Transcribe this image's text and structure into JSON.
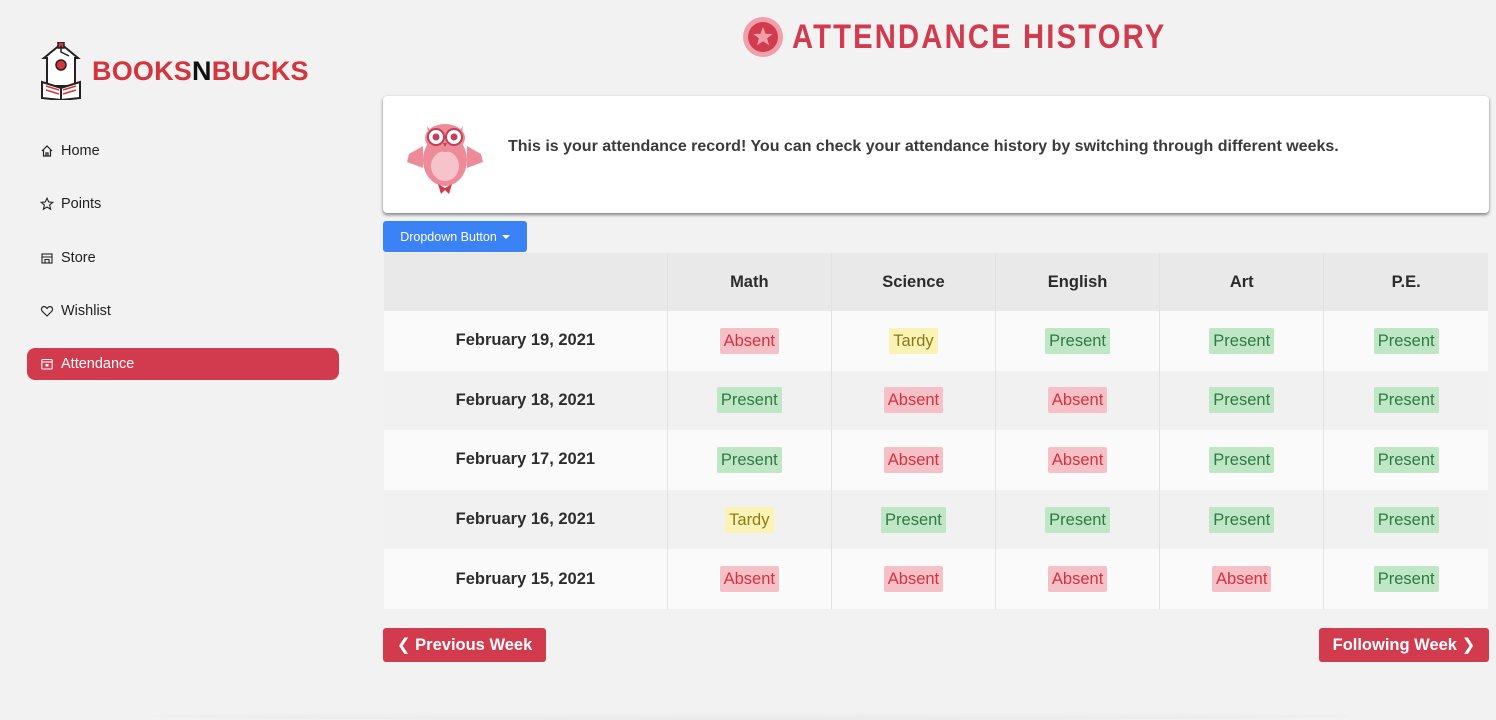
{
  "app": {
    "logo_part1": "BOOKS",
    "logo_part2": "N",
    "logo_part3": "BUCKS"
  },
  "sidebar": {
    "items": [
      {
        "label": "Home",
        "icon": "home-icon",
        "active": false
      },
      {
        "label": "Points",
        "icon": "star-icon",
        "active": false
      },
      {
        "label": "Store",
        "icon": "store-icon",
        "active": false
      },
      {
        "label": "Wishlist",
        "icon": "heart-icon",
        "active": false
      },
      {
        "label": "Attendance",
        "icon": "calendar-icon",
        "active": true
      }
    ]
  },
  "header": {
    "title": "ATTENDANCE HISTORY",
    "icon": "star-badge-icon"
  },
  "info": {
    "message": "This is your attendance record! You can check your attendance history by switching through different weeks.",
    "mascot": "owl-icon"
  },
  "dropdown": {
    "label": "Dropdown Button"
  },
  "table": {
    "columns": [
      "",
      "Math",
      "Science",
      "English",
      "Art",
      "P.E."
    ],
    "rows": [
      {
        "date": "February 19, 2021",
        "values": [
          "Absent",
          "Tardy",
          "Present",
          "Present",
          "Present"
        ]
      },
      {
        "date": "February 18, 2021",
        "values": [
          "Present",
          "Absent",
          "Absent",
          "Present",
          "Present"
        ]
      },
      {
        "date": "February 17, 2021",
        "values": [
          "Present",
          "Absent",
          "Absent",
          "Present",
          "Present"
        ]
      },
      {
        "date": "February 16, 2021",
        "values": [
          "Tardy",
          "Present",
          "Present",
          "Present",
          "Present"
        ]
      },
      {
        "date": "February 15, 2021",
        "values": [
          "Absent",
          "Absent",
          "Absent",
          "Absent",
          "Present"
        ]
      }
    ]
  },
  "buttons": {
    "prev": "❮ Previous Week",
    "next": "Following Week ❯"
  },
  "colors": {
    "accent": "#d23a4e",
    "primary_blue": "#3b82f6",
    "absent_bg": "#f5c1c7",
    "present_bg": "#bfe7c6",
    "tardy_bg": "#fbf2b5"
  }
}
